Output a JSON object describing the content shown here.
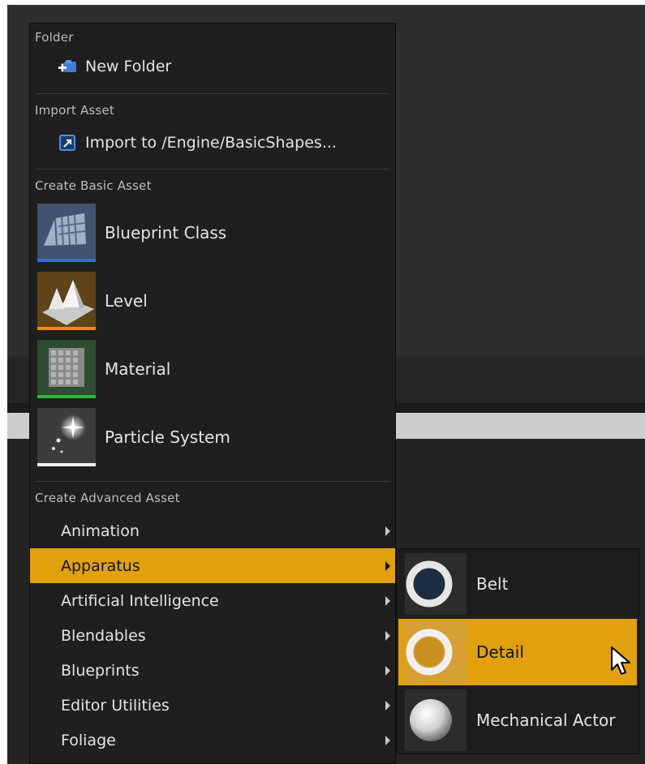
{
  "colors": {
    "highlight": "#e0a10c",
    "menu_bg": "#1f1f1f",
    "blueprint_bar": "#2f6de8",
    "level_bar": "#f08a00",
    "material_bar": "#35b438",
    "particle_bar": "#f2f2f2"
  },
  "menu": {
    "folder_header": "Folder",
    "new_folder": {
      "label": "New Folder",
      "icon": "new-folder-icon"
    },
    "import_header": "Import Asset",
    "import_item": {
      "label": "Import to /Engine/BasicShapes...",
      "icon": "import-icon"
    },
    "basic_header": "Create Basic Asset",
    "basic_items": [
      {
        "label": "Blueprint Class",
        "icon": "blueprint-class-icon"
      },
      {
        "label": "Level",
        "icon": "level-icon"
      },
      {
        "label": "Material",
        "icon": "material-icon"
      },
      {
        "label": "Particle System",
        "icon": "particle-system-icon"
      }
    ],
    "advanced_header": "Create Advanced Asset",
    "advanced_items": [
      {
        "label": "Animation",
        "highlighted": false
      },
      {
        "label": "Apparatus",
        "highlighted": true
      },
      {
        "label": "Artificial Intelligence",
        "highlighted": false
      },
      {
        "label": "Blendables",
        "highlighted": false
      },
      {
        "label": "Blueprints",
        "highlighted": false
      },
      {
        "label": "Editor Utilities",
        "highlighted": false
      },
      {
        "label": "Foliage",
        "highlighted": false
      }
    ]
  },
  "submenu": {
    "items": [
      {
        "label": "Belt",
        "icon": "belt-ring-icon",
        "highlighted": false
      },
      {
        "label": "Detail",
        "icon": "detail-ring-icon",
        "highlighted": true
      },
      {
        "label": "Mechanical Actor",
        "icon": "mechanical-actor-sphere-icon",
        "highlighted": false
      }
    ]
  }
}
